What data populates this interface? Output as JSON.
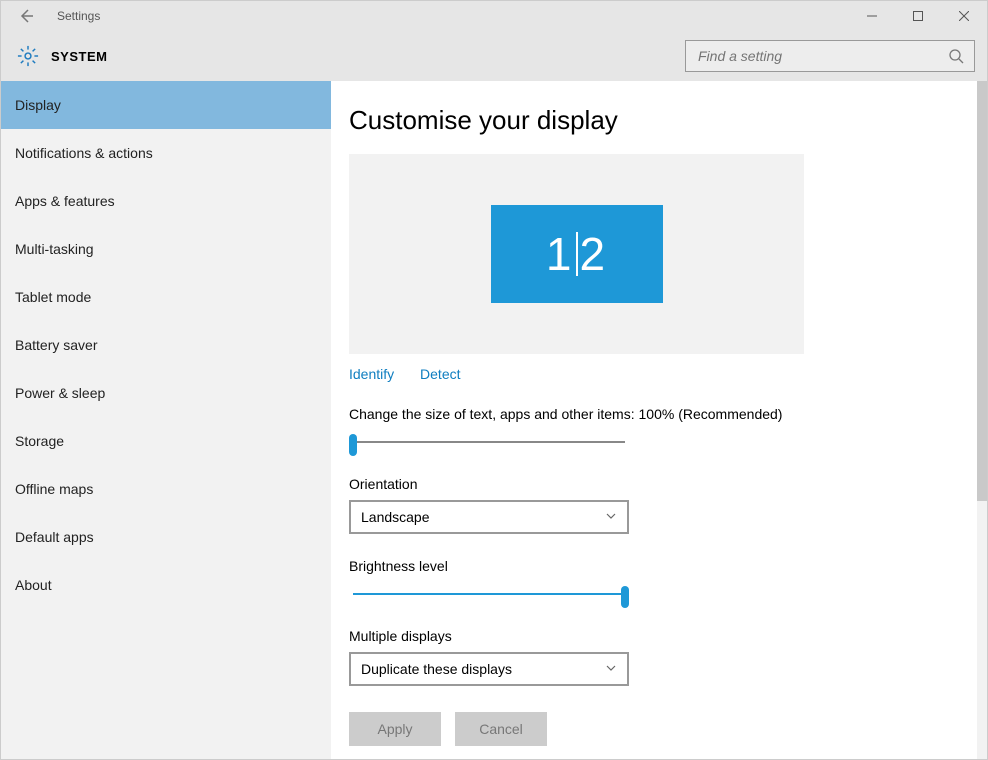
{
  "window": {
    "title": "Settings"
  },
  "header": {
    "section": "SYSTEM",
    "search_placeholder": "Find a setting"
  },
  "sidebar": {
    "selected_index": 0,
    "items": [
      {
        "label": "Display"
      },
      {
        "label": "Notifications & actions"
      },
      {
        "label": "Apps & features"
      },
      {
        "label": "Multi-tasking"
      },
      {
        "label": "Tablet mode"
      },
      {
        "label": "Battery saver"
      },
      {
        "label": "Power & sleep"
      },
      {
        "label": "Storage"
      },
      {
        "label": "Offline maps"
      },
      {
        "label": "Default apps"
      },
      {
        "label": "About"
      }
    ]
  },
  "main": {
    "heading": "Customise your display",
    "monitor_label_left": "1",
    "monitor_label_right": "2",
    "links": {
      "identify": "Identify",
      "detect": "Detect"
    },
    "scale_label": "Change the size of text, apps and other items: 100% (Recommended)",
    "scale_value_percent": 0,
    "orientation_label": "Orientation",
    "orientation_value": "Landscape",
    "brightness_label": "Brightness level",
    "brightness_value_percent": 100,
    "multi_label": "Multiple displays",
    "multi_value": "Duplicate these displays",
    "apply_label": "Apply",
    "cancel_label": "Cancel"
  }
}
